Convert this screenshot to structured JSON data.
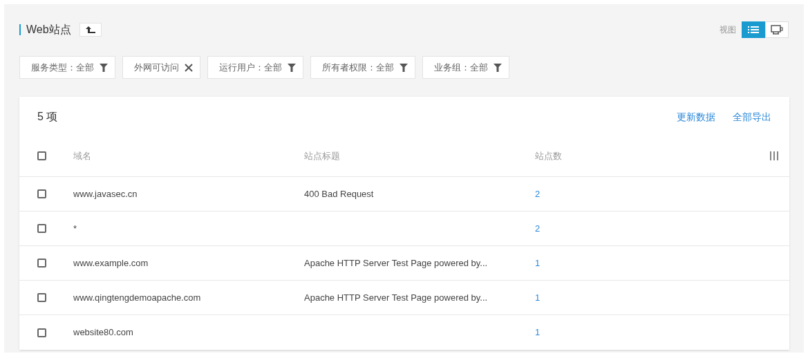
{
  "title": "Web站点",
  "filters": [
    {
      "label": "服务类型：全部",
      "kind": "filter"
    },
    {
      "label": "外网可访问",
      "kind": "remove"
    },
    {
      "label": "运行用户：全部",
      "kind": "filter"
    },
    {
      "label": "所有者权限：全部",
      "kind": "filter"
    },
    {
      "label": "业务组：全部",
      "kind": "filter"
    }
  ],
  "view": {
    "label": "视图",
    "options": [
      {
        "kind": "list",
        "selected": true
      },
      {
        "kind": "monitor",
        "selected": false
      }
    ]
  },
  "table": {
    "count": "5 项",
    "actions": [
      "更新数据",
      "全部导出"
    ],
    "select_all": {
      "checked": false
    },
    "columns": [
      "域名",
      "站点标题",
      "站点数"
    ],
    "rows": [
      {
        "checked": false,
        "cells": [
          "www.javasec.cn",
          "400 Bad Request",
          "2"
        ]
      },
      {
        "checked": false,
        "cells": [
          "*",
          "",
          "2"
        ]
      },
      {
        "checked": false,
        "cells": [
          "www.example.com",
          "Apache HTTP Server Test Page powered by...",
          "1"
        ]
      },
      {
        "checked": false,
        "cells": [
          "www.qingtengdemoapache.com",
          "Apache HTTP Server Test Page powered by...",
          "1"
        ]
      },
      {
        "checked": false,
        "cells": [
          "website80.com",
          "",
          "1"
        ]
      }
    ]
  }
}
